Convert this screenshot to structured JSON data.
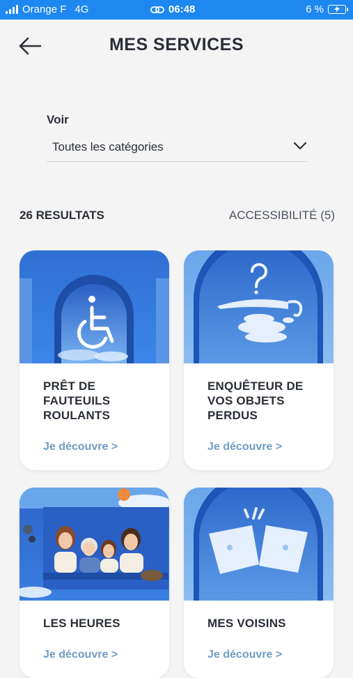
{
  "status_bar": {
    "carrier": "Orange F",
    "network": "4G",
    "time": "06:48",
    "battery": "6 %"
  },
  "header": {
    "title": "MES SERVICES",
    "back_icon": "arrow-left-icon"
  },
  "filter": {
    "label": "Voir",
    "selected": "Toutes les catégories"
  },
  "results": {
    "count_label": "26 RESULTATS",
    "active_filter": "ACCESSIBILITÉ (5)"
  },
  "cards": [
    {
      "title": "PRÊT DE FAUTEUILS ROULANTS",
      "link": "Je découvre >",
      "icon": "wheelchair-icon"
    },
    {
      "title": "ENQUÊTEUR DE VOS OBJETS PERDUS",
      "link": "Je découvre >",
      "icon": "lost-umbrella-icon"
    },
    {
      "title": "LES HEURES",
      "link": "Je découvre >",
      "icon": "family-photo"
    },
    {
      "title": "MES VOISINS",
      "link": "Je découvre >",
      "icon": "cloud-neighbors"
    }
  ],
  "colors": {
    "status_bar": "#1e88f0",
    "accent_link": "#6f9cc6",
    "card_sky": "#2d6fd6"
  }
}
